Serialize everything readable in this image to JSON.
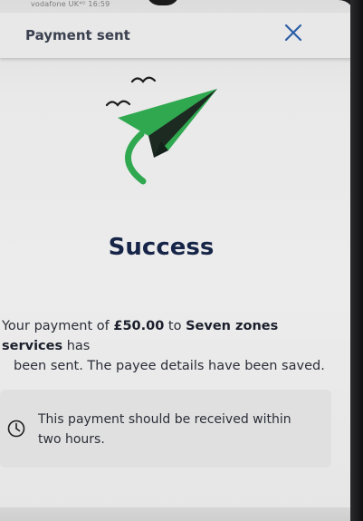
{
  "status_bar": {
    "text": "vodafone UK⁴ᴳ  16:59"
  },
  "header": {
    "title": "Payment sent",
    "close_icon": "close-icon"
  },
  "illustration": {
    "icon": "paper-plane-icon",
    "accent": "#2fa84f",
    "dark": "#1d2a22"
  },
  "main": {
    "title": "Success",
    "message_prefix": "Your payment of ",
    "amount": "£50.00",
    "message_mid": " to ",
    "payee": "Seven zones services",
    "message_suffix_line1": " has",
    "message_line2": "been sent. The payee details have been saved."
  },
  "info": {
    "icon": "clock-icon",
    "line1": "This payment should be received within",
    "line2": "two hours."
  },
  "colors": {
    "title": "#162447",
    "accent_green": "#2fa84f",
    "close_blue": "#2b5ea7"
  }
}
